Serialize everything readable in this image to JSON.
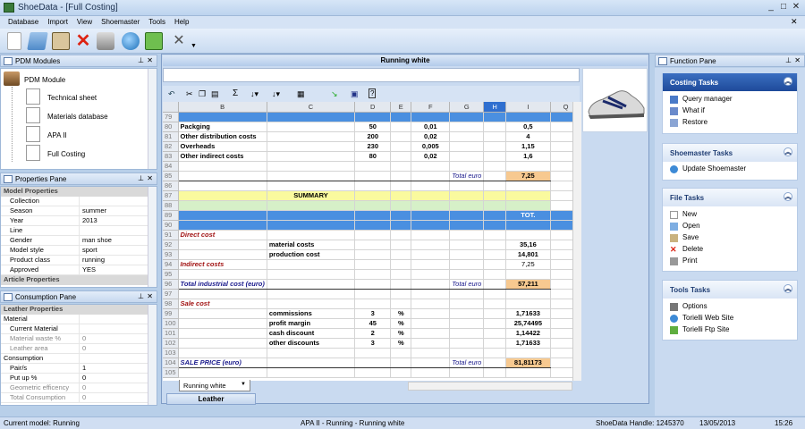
{
  "app_title": "ShoeData - [Full Costing]",
  "menu": [
    "Database",
    "Import",
    "View",
    "Shoemaster",
    "Tools",
    "Help"
  ],
  "pdm": {
    "title": "PDM Modules",
    "root": "PDM Module",
    "items": [
      "Technical sheet",
      "Materials database",
      "APA II",
      "Full Costing"
    ]
  },
  "properties": {
    "title": "Properties Pane",
    "cat_model": "Model Properties",
    "rows": [
      {
        "k": "Collection",
        "v": ""
      },
      {
        "k": "Season",
        "v": "summer"
      },
      {
        "k": "Year",
        "v": "2013"
      },
      {
        "k": "Line",
        "v": ""
      },
      {
        "k": "Gender",
        "v": "man shoe"
      },
      {
        "k": "Model style",
        "v": "sport"
      },
      {
        "k": "Product class",
        "v": "running"
      },
      {
        "k": "Approved",
        "v": "YES"
      }
    ],
    "cat_article": "Article Properties"
  },
  "consumption": {
    "title": "Consumption Pane",
    "cat_leather": "Leather Properties",
    "sub_material": "Material",
    "rows1": [
      {
        "k": "Current Material",
        "v": "",
        "gray": false
      },
      {
        "k": "Material waste %",
        "v": "0",
        "gray": true
      },
      {
        "k": "Leather area",
        "v": "0",
        "gray": true
      }
    ],
    "sub_consumption": "Consumption",
    "rows2": [
      {
        "k": "Pair/s",
        "v": "1",
        "gray": false
      },
      {
        "k": "Put up %",
        "v": "0",
        "gray": false
      },
      {
        "k": "Geometric efficency",
        "v": "0",
        "gray": true
      },
      {
        "k": "Total Consumption",
        "v": "0",
        "gray": true
      }
    ]
  },
  "sheet": {
    "title": "Running white",
    "tab": "Running white",
    "bottom_tab": "Leather",
    "columns": [
      "",
      "B",
      "C",
      "D",
      "E",
      "F",
      "G",
      "H",
      "I",
      "Q"
    ],
    "rows": [
      {
        "n": "79",
        "c": [
          "",
          "",
          "",
          "",
          "",
          "",
          "",
          ""
        ],
        "style": "blue"
      },
      {
        "n": "80",
        "c": [
          "Packging",
          "",
          "50",
          "",
          "0,01",
          "",
          "",
          "0,5"
        ],
        "style": "bold"
      },
      {
        "n": "81",
        "c": [
          "Other distribution costs",
          "",
          "200",
          "",
          "0,02",
          "",
          "",
          "4"
        ],
        "style": "bold"
      },
      {
        "n": "82",
        "c": [
          "Overheads",
          "",
          "230",
          "",
          "0,005",
          "",
          "",
          "1,15"
        ],
        "style": "bold"
      },
      {
        "n": "83",
        "c": [
          "Other indirect costs",
          "",
          "80",
          "",
          "0,02",
          "",
          "",
          "1,6"
        ],
        "style": "bold"
      },
      {
        "n": "84",
        "c": [
          "",
          "",
          "",
          "",
          "",
          "",
          "",
          ""
        ],
        "style": ""
      },
      {
        "n": "85",
        "c": [
          "",
          "",
          "",
          "",
          "",
          "Total euro",
          "",
          "7,25"
        ],
        "style": "total"
      },
      {
        "n": "86",
        "c": [
          "",
          "",
          "",
          "",
          "",
          "",
          "",
          ""
        ],
        "style": ""
      },
      {
        "n": "87",
        "c": [
          "",
          "SUMMARY",
          "",
          "",
          "",
          "",
          "",
          ""
        ],
        "style": "summary"
      },
      {
        "n": "88",
        "c": [
          "",
          "",
          "",
          "",
          "",
          "",
          "",
          ""
        ],
        "style": "green"
      },
      {
        "n": "89",
        "c": [
          "",
          "",
          "",
          "",
          "",
          "",
          "",
          "TOT."
        ],
        "style": "blue"
      },
      {
        "n": "90",
        "c": [
          "",
          "",
          "",
          "",
          "",
          "",
          "",
          ""
        ],
        "style": "blue"
      },
      {
        "n": "91",
        "c": [
          "Direct cost",
          "",
          "",
          "",
          "",
          "",
          "",
          ""
        ],
        "style": "red"
      },
      {
        "n": "92",
        "c": [
          "",
          "material costs",
          "",
          "",
          "",
          "",
          "",
          "35,16"
        ],
        "style": "bold"
      },
      {
        "n": "93",
        "c": [
          "",
          "production cost",
          "",
          "",
          "",
          "",
          "",
          "14,801"
        ],
        "style": "bold"
      },
      {
        "n": "94",
        "c": [
          "Indirect costs",
          "",
          "",
          "",
          "",
          "",
          "",
          "7,25"
        ],
        "style": "red"
      },
      {
        "n": "95",
        "c": [
          "",
          "",
          "",
          "",
          "",
          "",
          "",
          ""
        ],
        "style": ""
      },
      {
        "n": "96",
        "c": [
          "Total industrial cost (euro)",
          "",
          "",
          "",
          "",
          "Total euro",
          "",
          "57,211"
        ],
        "style": "total"
      },
      {
        "n": "97",
        "c": [
          "",
          "",
          "",
          "",
          "",
          "",
          "",
          ""
        ],
        "style": ""
      },
      {
        "n": "98",
        "c": [
          "Sale cost",
          "",
          "",
          "",
          "",
          "",
          "",
          ""
        ],
        "style": "red"
      },
      {
        "n": "99",
        "c": [
          "",
          "commissions",
          "3",
          "%",
          "",
          "",
          "",
          "1,71633"
        ],
        "style": "bold"
      },
      {
        "n": "100",
        "c": [
          "",
          "profit margin",
          "45",
          "%",
          "",
          "",
          "",
          "25,74495"
        ],
        "style": "bold"
      },
      {
        "n": "101",
        "c": [
          "",
          "cash discount",
          "2",
          "%",
          "",
          "",
          "",
          "1,14422"
        ],
        "style": "bold"
      },
      {
        "n": "102",
        "c": [
          "",
          "other discounts",
          "3",
          "%",
          "",
          "",
          "",
          "1,71633"
        ],
        "style": "bold"
      },
      {
        "n": "103",
        "c": [
          "",
          "",
          "",
          "",
          "",
          "",
          "",
          ""
        ],
        "style": ""
      },
      {
        "n": "104",
        "c": [
          "SALE PRICE (euro)",
          "",
          "",
          "",
          "",
          "Total euro",
          "",
          "81,81173"
        ],
        "style": "total"
      },
      {
        "n": "105",
        "c": [
          "",
          "",
          "",
          "",
          "",
          "",
          "",
          ""
        ],
        "style": ""
      }
    ]
  },
  "function_pane": {
    "title": "Function Pane",
    "groups": [
      {
        "title": "Costing Tasks",
        "items": [
          "Query manager",
          "What if",
          "Restore"
        ]
      },
      {
        "title": "Shoemaster Tasks",
        "items": [
          "Update Shoemaster"
        ]
      },
      {
        "title": "File Tasks",
        "items": [
          "New",
          "Open",
          "Save",
          "Delete",
          "Print"
        ]
      },
      {
        "title": "Tools Tasks",
        "items": [
          "Options",
          "Torielli Web Site",
          "Torielli Ftp Site"
        ]
      }
    ]
  },
  "status": {
    "model": "Current model: Running",
    "center": "APA II - Running - Running white",
    "handle": "ShoeData Handle: 1245370",
    "date": "13/05/2013",
    "time": "15:26"
  }
}
